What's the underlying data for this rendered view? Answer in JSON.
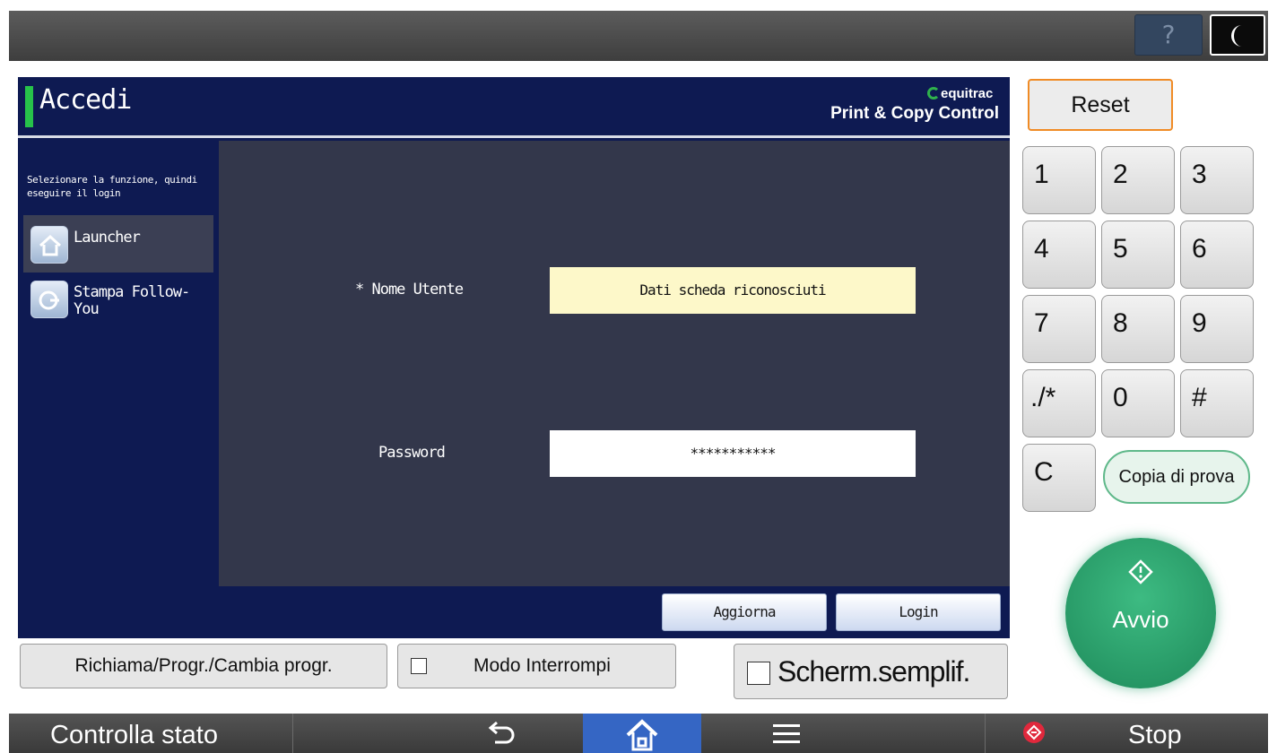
{
  "topbar": {
    "help_label": "?",
    "night_icon": "moon-icon"
  },
  "panel": {
    "title": "Accedi",
    "brand_name": "equitrac",
    "brand_subtitle": "Print & Copy Control",
    "hint": "Selezionare la funzione, quindi eseguire il login",
    "sidebar_items": [
      {
        "label": "Launcher",
        "icon": "home-icon",
        "active": true
      },
      {
        "label": "Stampa Follow-You",
        "icon": "print-release-icon",
        "active": false
      }
    ],
    "username_label": "* Nome Utente",
    "username_value": "Dati scheda riconosciuti",
    "password_label": "Password",
    "password_value": "***********",
    "refresh_label": "Aggiorna",
    "login_label": "Login"
  },
  "function_buttons": {
    "recall_label": "Richiama/Progr./Cambia progr.",
    "interrupt_label": "Modo Interrompi",
    "simple_screen_label": "Scherm.semplif."
  },
  "keypad": {
    "reset_label": "Reset",
    "keys": [
      "1",
      "2",
      "3",
      "4",
      "5",
      "6",
      "7",
      "8",
      "9",
      "./*",
      "0",
      "#",
      "C"
    ],
    "test_copy_label": "Copia di prova",
    "start_label": "Avvio"
  },
  "bottombar": {
    "status_label": "Controlla stato",
    "stop_label": "Stop"
  },
  "colors": {
    "panel_bg": "#0e1a52",
    "content_bg": "#33374b",
    "accent_green": "#27c24a",
    "reset_border": "#f08b25",
    "start_green": "#2fa56f",
    "home_tab": "#3566c4",
    "stop_red": "#e0283c"
  }
}
